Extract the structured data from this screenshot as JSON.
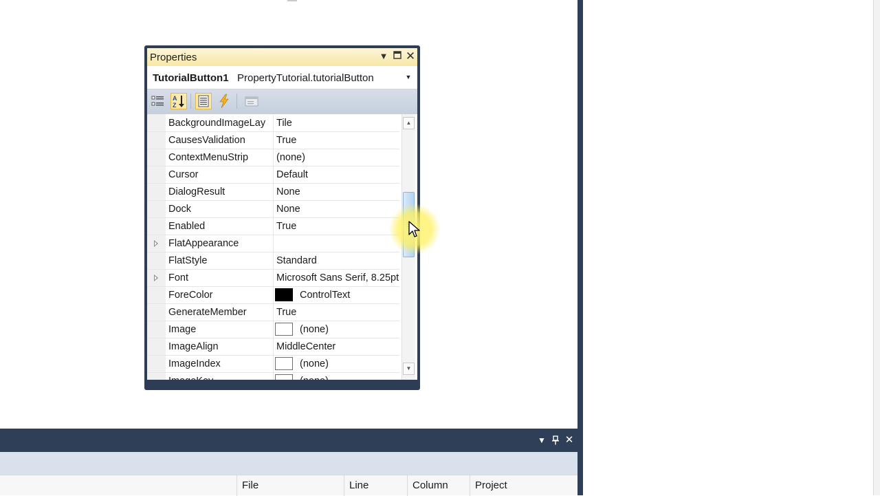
{
  "properties_window": {
    "title": "Properties",
    "object_name": "TutorialButton1",
    "object_type": "PropertyTutorial.tutorialButton",
    "toolbar_icons": [
      "categorized-icon",
      "alphabetical-sort-icon",
      "properties-icon",
      "events-icon",
      "property-pages-icon"
    ],
    "rows": [
      {
        "name": "BackgroundImageLay",
        "value": "Tile"
      },
      {
        "name": "CausesValidation",
        "value": "True"
      },
      {
        "name": "ContextMenuStrip",
        "value": "(none)"
      },
      {
        "name": "Cursor",
        "value": "Default"
      },
      {
        "name": "DialogResult",
        "value": "None"
      },
      {
        "name": "Dock",
        "value": "None"
      },
      {
        "name": "Enabled",
        "value": "True"
      },
      {
        "name": "FlatAppearance",
        "value": "",
        "expandable": true
      },
      {
        "name": "FlatStyle",
        "value": "Standard"
      },
      {
        "name": "Font",
        "value": "Microsoft Sans Serif, 8.25pt",
        "expandable": true
      },
      {
        "name": "ForeColor",
        "value": "ControlText",
        "swatch": "#000000"
      },
      {
        "name": "GenerateMember",
        "value": "True"
      },
      {
        "name": "Image",
        "value": "(none)",
        "swatch": "#ffffff"
      },
      {
        "name": "ImageAlign",
        "value": "MiddleCenter"
      },
      {
        "name": "ImageIndex",
        "value": "(none)",
        "swatch": "#ffffff"
      },
      {
        "name": "ImageKey",
        "value": "(none)",
        "swatch": "#ffffff"
      }
    ]
  },
  "bottom_panel": {
    "columns": [
      "File",
      "Line",
      "Column",
      "Project"
    ]
  },
  "colors": {
    "frame": "#2e3d54",
    "title_bar": "#f7e7a6",
    "toolbar": "#cfd7e4"
  }
}
